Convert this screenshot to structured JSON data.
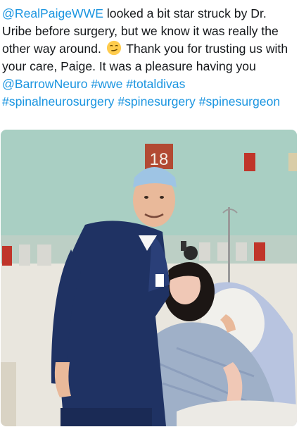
{
  "tweet": {
    "segments": [
      {
        "type": "mention",
        "text": "@RealPaigeWWE"
      },
      {
        "type": "text",
        "text": " looked a bit star struck by Dr. Uribe before surgery, but we know it was really the other way around. "
      },
      {
        "type": "emoji",
        "name": "smirking-face-emoji"
      },
      {
        "type": "text",
        "text": "  Thank you for trusting us with your care, Paige. It was a pleasure having you "
      },
      {
        "type": "mention",
        "text": "@BarrowNeuro"
      },
      {
        "type": "text",
        "text": " "
      },
      {
        "type": "hashtag",
        "text": "#wwe"
      },
      {
        "type": "text",
        "text": " "
      },
      {
        "type": "hashtag",
        "text": "#totaldivas"
      },
      {
        "type": "text",
        "text": " "
      },
      {
        "type": "hashtag",
        "text": "#spinalneurosurgery"
      },
      {
        "type": "text",
        "text": " "
      },
      {
        "type": "hashtag",
        "text": "#spinesurgery"
      },
      {
        "type": "text",
        "text": " "
      },
      {
        "type": "hashtag",
        "text": "#spinesurgeon"
      }
    ]
  },
  "photo": {
    "room_number": "18",
    "colors": {
      "wall_upper": "#a9cfc3",
      "wall_lower": "#e9e6de",
      "scrubs": "#1f3263",
      "gown": "#9fb0c8",
      "room_sign": "#b24a33"
    }
  }
}
